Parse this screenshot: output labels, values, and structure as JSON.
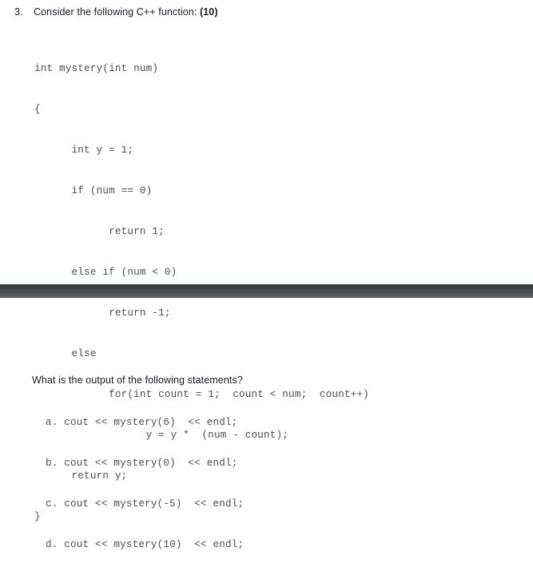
{
  "question": {
    "number": "3.",
    "prompt": "Consider the following C++ function: ",
    "marks": "(10)"
  },
  "code": {
    "lines": [
      "int mystery(int num)",
      "{",
      "      int y = 1;",
      "      if (num == 0)",
      "            return 1;",
      "      else if (num < 0)",
      "            return -1;",
      "      else",
      "            for(int count = 1;  count < num;  count++)",
      "                  y = y *  (num - count);",
      "      return y;",
      "}"
    ]
  },
  "lower_section": {
    "output_question": "What is the output of the following statements?",
    "statements": [
      "a. cout << mystery(6)  << endl;",
      "b. cout << mystery(0)  << endl;",
      "c. cout << mystery(-5)  << endl;",
      "d. cout << mystery(10)  << endl;"
    ]
  },
  "colors": {
    "page_background": "#ffffff",
    "heading_text": "#1b1b26",
    "code_text": "#4d4d4d",
    "band_top": "#32373a",
    "band_bottom": "#606567"
  }
}
